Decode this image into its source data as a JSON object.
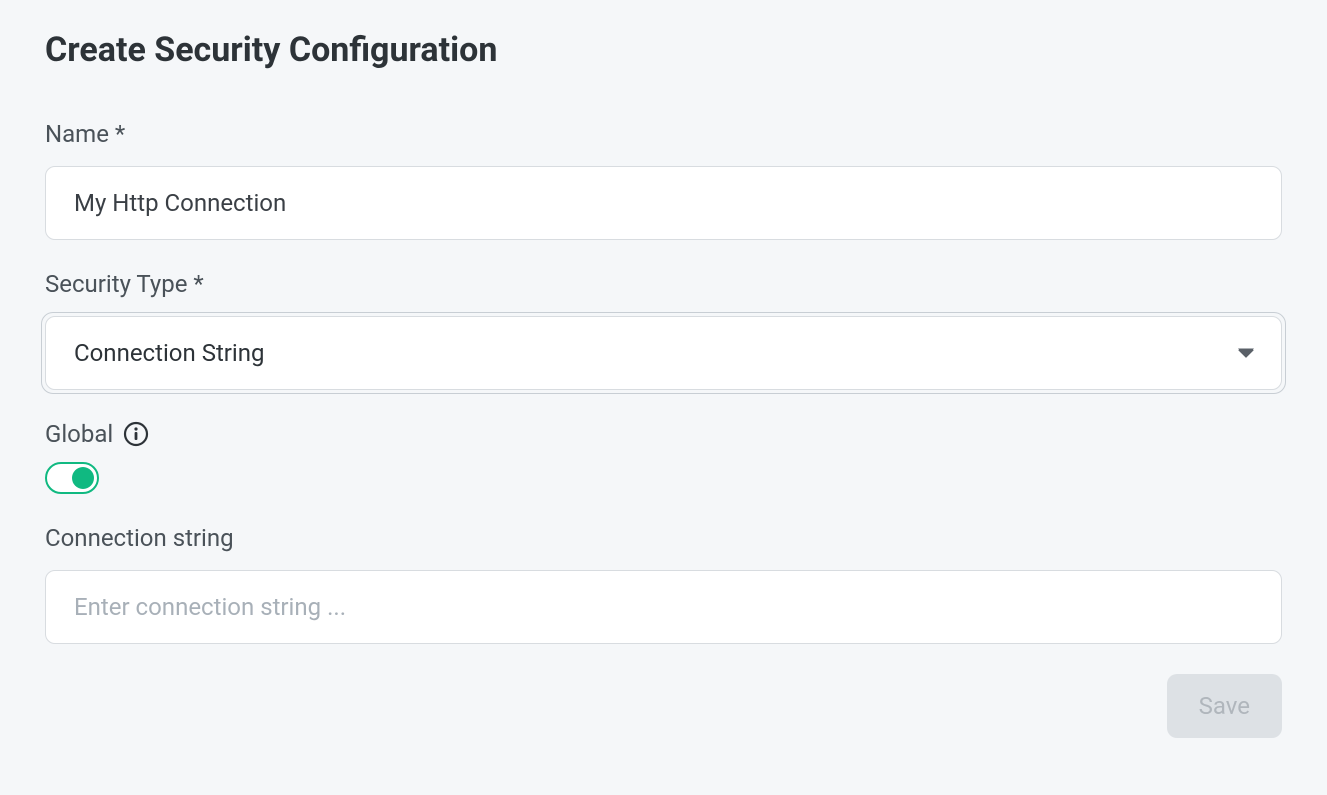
{
  "page_title": "Create Security Configuration",
  "fields": {
    "name": {
      "label": "Name *",
      "value": "My Http Connection"
    },
    "security_type": {
      "label": "Security Type *",
      "value": "Connection String"
    },
    "global": {
      "label": "Global",
      "enabled": true
    },
    "connection_string": {
      "label": "Connection string",
      "placeholder": "Enter connection string ...",
      "value": ""
    }
  },
  "buttons": {
    "save": "Save"
  }
}
